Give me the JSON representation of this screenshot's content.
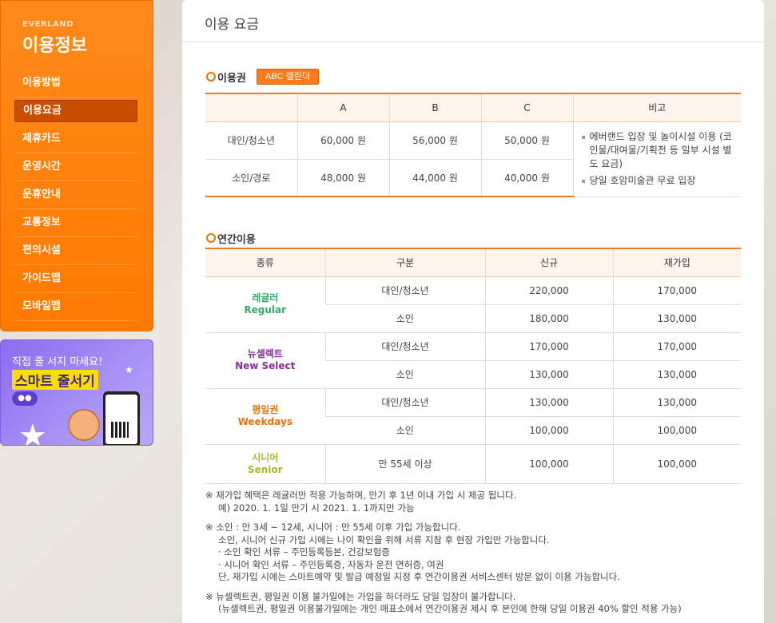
{
  "brand": {
    "sub": "EVERLAND",
    "title": "이용정보"
  },
  "menu": {
    "items": [
      {
        "label": "이용방법"
      },
      {
        "label": "이용요금"
      },
      {
        "label": "제휴카드"
      },
      {
        "label": "운영시간"
      },
      {
        "label": "운휴안내"
      },
      {
        "label": "교통정보"
      },
      {
        "label": "편의시설"
      },
      {
        "label": "가이드맵"
      },
      {
        "label": "모바일맵"
      }
    ],
    "active_index": 1
  },
  "promo": {
    "line1": "직접 줄 서지 마세요!",
    "line2": "스마트 줄서기"
  },
  "page": {
    "title": "이용 요금"
  },
  "ticket": {
    "section_title": "이용권",
    "calendar_button": "ABC 캘린더",
    "headers": [
      "",
      "A",
      "B",
      "C",
      "비고"
    ],
    "rows": [
      {
        "label": "대인/청소년",
        "a": "60,000 원",
        "b": "56,000 원",
        "c": "50,000 원"
      },
      {
        "label": "소인/경로",
        "a": "48,000 원",
        "b": "44,000 원",
        "c": "40,000 원"
      }
    ],
    "notes": [
      "에버랜드 입장 및 놀이시설 이용 (코인물/대여물/기획전 등 일부 시설 별도 요금)",
      "당일 호암미술관 무료 입장"
    ]
  },
  "annual": {
    "section_title": "연간이용",
    "headers": [
      "종류",
      "구분",
      "신규",
      "재가입"
    ],
    "groups": [
      {
        "ko": "레귤러",
        "en": "Regular",
        "rows": [
          {
            "type": "대인/청소년",
            "new": "220,000",
            "rejoin": "170,000"
          },
          {
            "type": "소인",
            "new": "180,000",
            "rejoin": "130,000"
          }
        ]
      },
      {
        "ko": "뉴셀렉트",
        "en": "New Select",
        "rows": [
          {
            "type": "대인/청소년",
            "new": "170,000",
            "rejoin": "170,000"
          },
          {
            "type": "소인",
            "new": "130,000",
            "rejoin": "130,000"
          }
        ]
      },
      {
        "ko": "평일권",
        "en": "Weekdays",
        "rows": [
          {
            "type": "대인/청소년",
            "new": "130,000",
            "rejoin": "130,000"
          },
          {
            "type": "소인",
            "new": "100,000",
            "rejoin": "100,000"
          }
        ]
      },
      {
        "ko": "시니어",
        "en": "Senior",
        "rows": [
          {
            "type": "만 55세 이상",
            "new": "100,000",
            "rejoin": "100,000"
          }
        ]
      }
    ]
  },
  "footnotes": [
    "※ 재가입 혜택은 레귤러만 적용 가능하며, 만기 후 1년 이내 가입 시 제공 됩니다.",
    "예) 2020. 1. 1일 만기 시 2021. 1. 1까지만 가능",
    "※ 소인 : 만 3세 ~ 12세, 시니어 : 만 55세 이후 가입 가능합니다.",
    "소인, 시니어 신규 가입 시에는 나이 확인을 위해 서류 지참 후 현장 가입만 가능합니다.",
    "· 소인 확인 서류 – 주민등록등본, 건강보험증",
    "· 시니어 확인 서류 – 주민등록증, 자동차 운전 면허증, 여권",
    "단, 재가입 시에는 스마트예약 및 발급 예정일 지정 후 연간이용권 서비스센터 방문 없이 이용 가능합니다.",
    "※ 뉴셀렉트권, 평일권 이용 불가일에는 가입을 하더라도 당일 입장이 불가합니다.",
    "(뉴셀렉트권, 평일권 이용불가일에는 개인 매표소에서 연간이용권 제시 후 본인에 한해 당일 이용권 40% 할인 적용 가능)"
  ],
  "colors": {
    "accent": "#ff7a00",
    "active_menu": "#c94e00",
    "table_line": "#f07a22"
  }
}
